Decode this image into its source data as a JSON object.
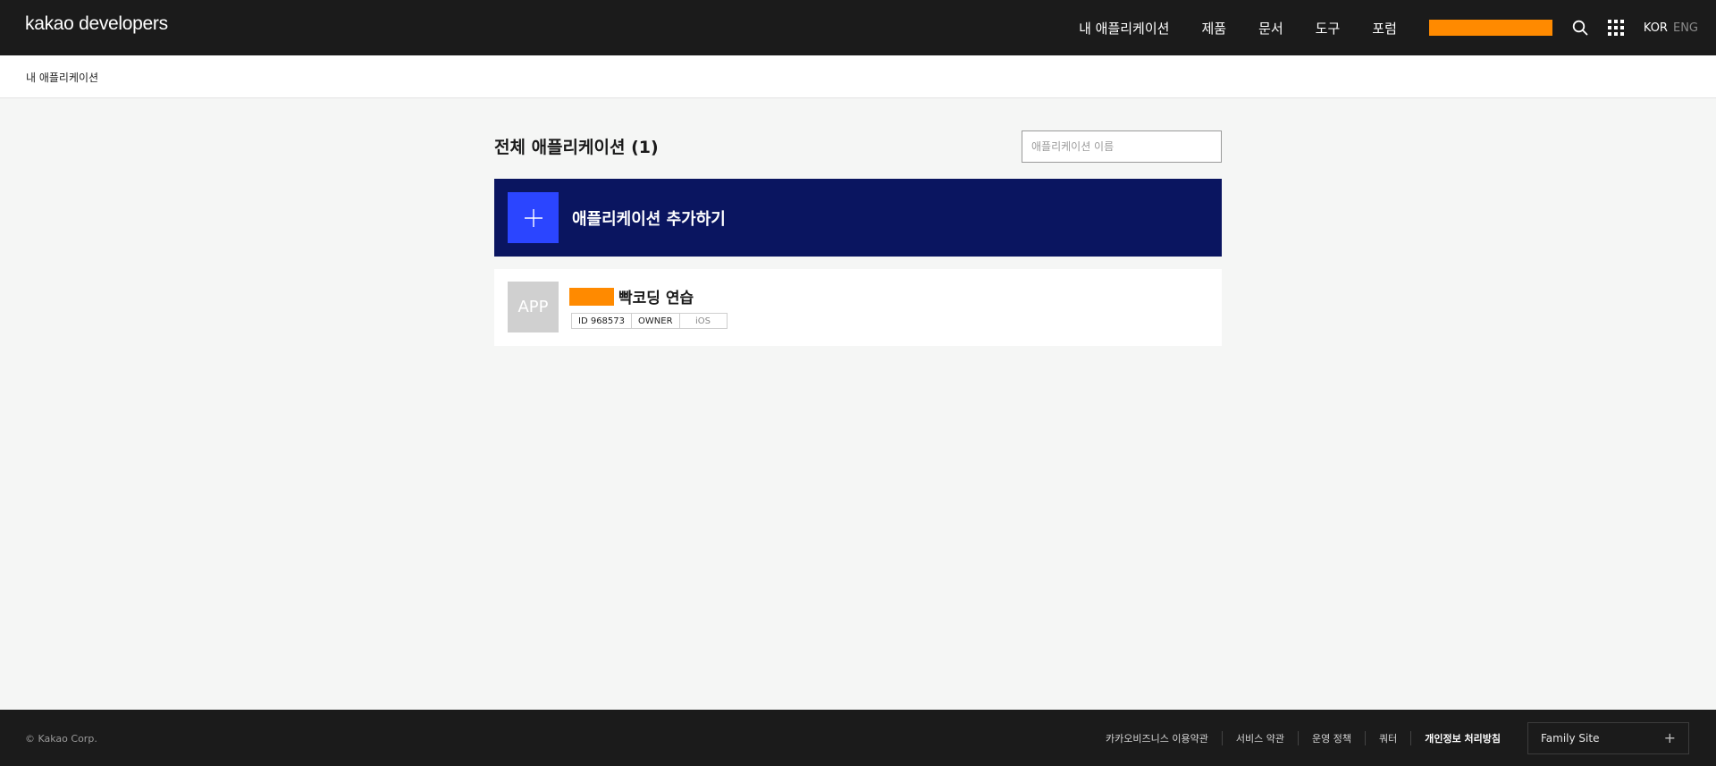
{
  "header": {
    "logo_text_bold": "kakao",
    "logo_text_light": " developers",
    "nav": [
      "내 애플리케이션",
      "제품",
      "문서",
      "도구",
      "포럼"
    ],
    "user_name_redacted_color": "#ff8a00",
    "search_icon": "search-icon",
    "apps_icon": "grid-icon",
    "lang_active": "KOR",
    "lang_inactive": "ENG"
  },
  "breadcrumb": "내 애플리케이션",
  "main": {
    "title": "전체 애플리케이션 (1)",
    "search_placeholder": "애플리케이션 이름",
    "add_label": "애플리케이션 추가하기",
    "add_icon": "plus-icon"
  },
  "apps": [
    {
      "thumb_text": "APP",
      "name": "빡코딩 연습",
      "tags": [
        "ID 968573",
        "OWNER",
        "iOS"
      ]
    }
  ],
  "footer": {
    "copyright": "© Kakao Corp.",
    "links": [
      "카카오비즈니스 이용약관",
      "서비스 약관",
      "운영 정책",
      "쿼터",
      "개인정보 처리방침"
    ],
    "family_site": "Family Site"
  },
  "colors": {
    "header_bg": "#1b1b1b",
    "add_card_bg": "#0a1560",
    "add_icon_bg": "#2b45ff",
    "redaction": "#ff8a00",
    "page_bg": "#f5f6f5"
  }
}
